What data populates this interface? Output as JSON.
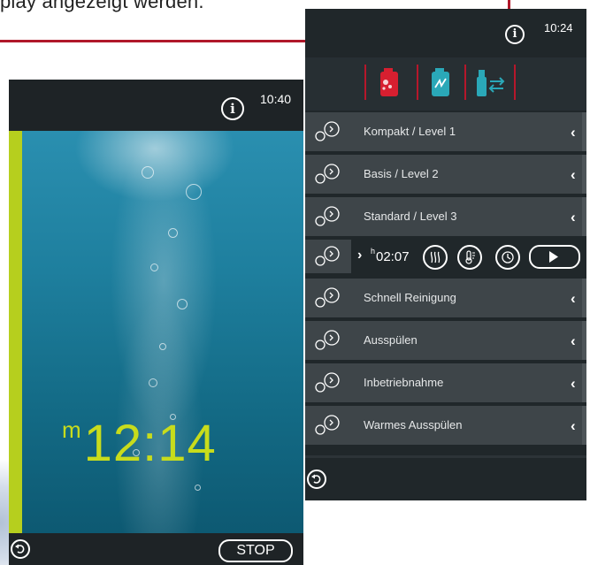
{
  "document": {
    "caption_fragment": "play angezeigt werden."
  },
  "left_screen": {
    "time": "10:40",
    "info_icon_glyph": "i",
    "countdown_unit": "m",
    "countdown_value": "12:14",
    "stop_label": "STOP",
    "accent_color": "#b6cf1e"
  },
  "right_screen": {
    "time": "10:24",
    "info_icon_glyph": "i",
    "top_icons": [
      "dishwasher-detergent-icon",
      "dishwasher-rinse-icon",
      "spray-bottle-transfer-icon"
    ],
    "programs": [
      {
        "label": "Kompakt / Level 1"
      },
      {
        "label": "Basis / Level 2"
      },
      {
        "label": "Standard / Level 3"
      }
    ],
    "active_program": {
      "hour_unit": "h",
      "time": "02:07",
      "option_icons": [
        "steam-icon",
        "thermometer-icon",
        "timer-icon"
      ],
      "play_icon": "play-icon"
    },
    "programs_after": [
      {
        "label": "Schnell Reinigung"
      },
      {
        "label": "Ausspülen"
      },
      {
        "label": "Inbetriebnahme"
      },
      {
        "label": "Warmes Ausspülen"
      }
    ],
    "chevron_glyph": "‹",
    "accent_color": "#b6172b"
  }
}
